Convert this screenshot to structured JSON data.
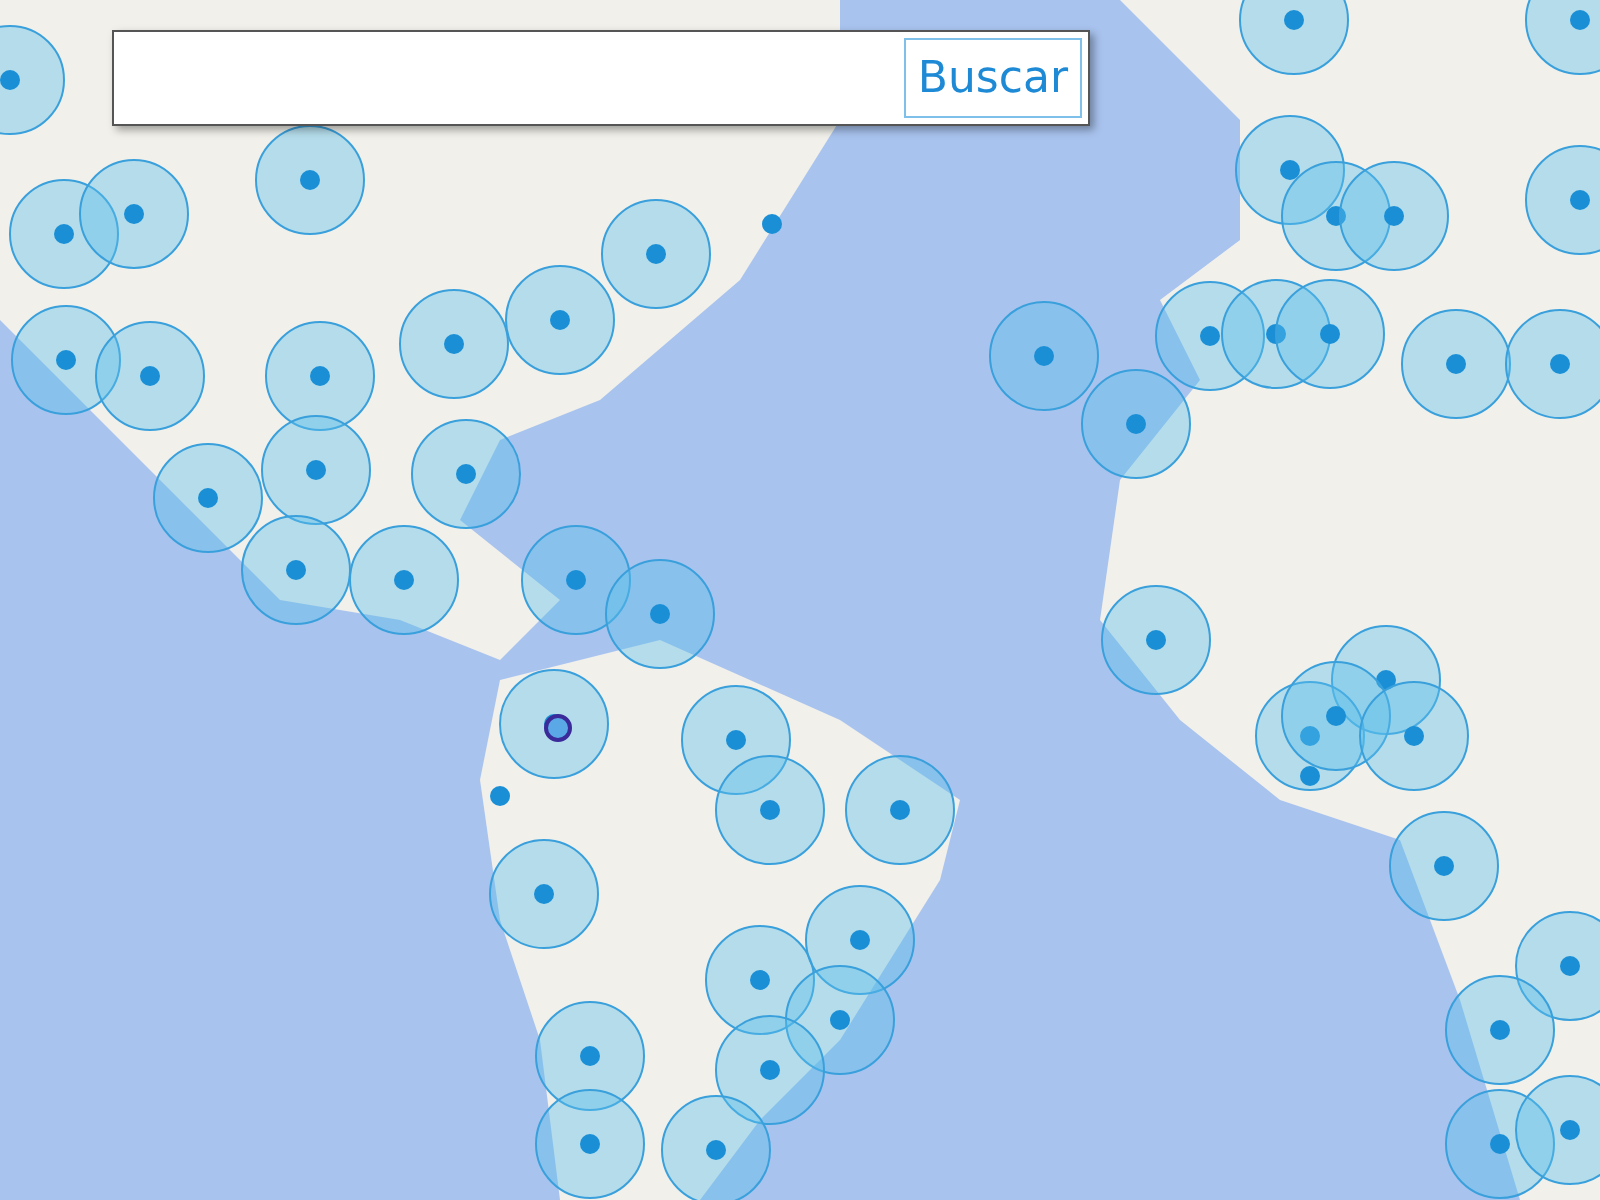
{
  "search": {
    "button": "Buscar"
  }
}
